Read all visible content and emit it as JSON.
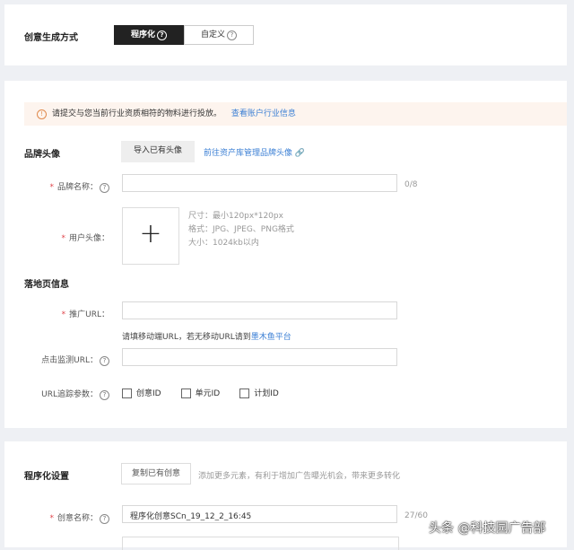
{
  "mode": {
    "label": "创意生成方式",
    "options": [
      {
        "label": "程序化",
        "active": true
      },
      {
        "label": "自定义",
        "active": false
      }
    ]
  },
  "notice": {
    "text": "请提交与您当前行业资质相符的物料进行投放。",
    "link": "查看账户行业信息"
  },
  "brand": {
    "title": "品牌头像",
    "import_button": "导入已有头像",
    "manage_link": "前往资产库管理品牌头像",
    "name_label": "品牌名称：",
    "name_value": "",
    "name_count": "0/8",
    "avatar_label": "用户头像：",
    "avatar_hints": [
      "尺寸：最小120px*120px",
      "格式：JPG、JPEG、PNG格式",
      "大小：1024kb以内"
    ]
  },
  "landing": {
    "title": "落地页信息",
    "url_label": "推广URL：",
    "url_value": "",
    "url_hint": "请填移动端URL，若无移动URL请到",
    "url_hint_link": "墨木鱼平台",
    "monitor_label": "点击监测URL：",
    "monitor_value": "",
    "params_label": "URL追踪参数：",
    "params": [
      "创意ID",
      "单元ID",
      "计划ID"
    ]
  },
  "programmatic": {
    "title": "程序化设置",
    "copy_button": "复制已有创意",
    "copy_hint": "添加更多元素，有利于增加广告曝光机会，带来更多转化",
    "name_label": "创意名称：",
    "name_value": "程序化创意SCn_19_12_2_16:45",
    "name_count": "27/60"
  },
  "watermark": "头条 @科技园广告部"
}
